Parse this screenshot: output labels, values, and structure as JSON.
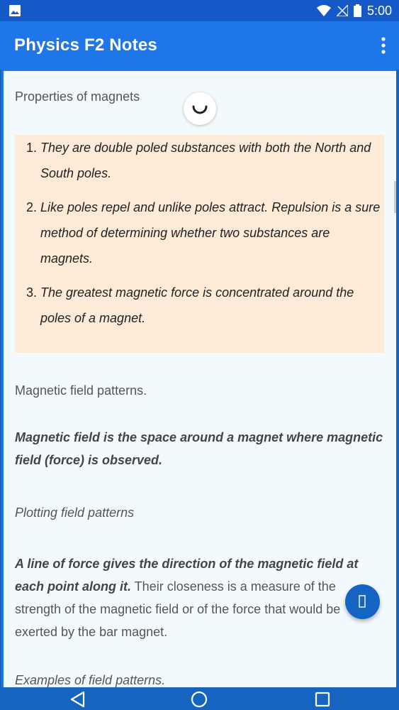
{
  "status_bar": {
    "time": "5:00",
    "icons": [
      "gallery-icon",
      "wifi-icon",
      "no-signal-icon",
      "battery-icon"
    ]
  },
  "app_bar": {
    "title": "Physics F2 Notes",
    "overflow_icon": "more-vert-icon"
  },
  "content": {
    "heading_properties": "Properties of magnets",
    "properties": [
      "They are double poled substances with both the North and South poles.",
      "Like poles repel and unlike poles attract. Repulsion is a sure method of determining whether two substances are magnets.",
      "The greatest magnetic force is concentrated around the poles of a magnet."
    ],
    "heading_field_patterns": "Magnetic field patterns.",
    "definition": "Magnetic field is the space around a magnet where magnetic field (force) is observed.",
    "heading_plotting": "Plotting field patterns",
    "line_of_force_bold": "A line of force gives the direction of the magnetic field at each point along it.",
    "line_of_force_rest": " Their closeness is a measure of the strength of the magnetic field or of the force that would be exerted by the bar magnet.",
    "heading_examples": "Examples of field patterns."
  },
  "fab": {
    "icon": "fab-icon"
  },
  "nav_bar": {
    "icons": [
      "back-icon",
      "home-icon",
      "recents-icon"
    ]
  },
  "colors": {
    "primary": "#1e76e8",
    "status_bar": "#1558c8",
    "note_box": "#fdebd7",
    "content_bg": "#f3fafd"
  }
}
